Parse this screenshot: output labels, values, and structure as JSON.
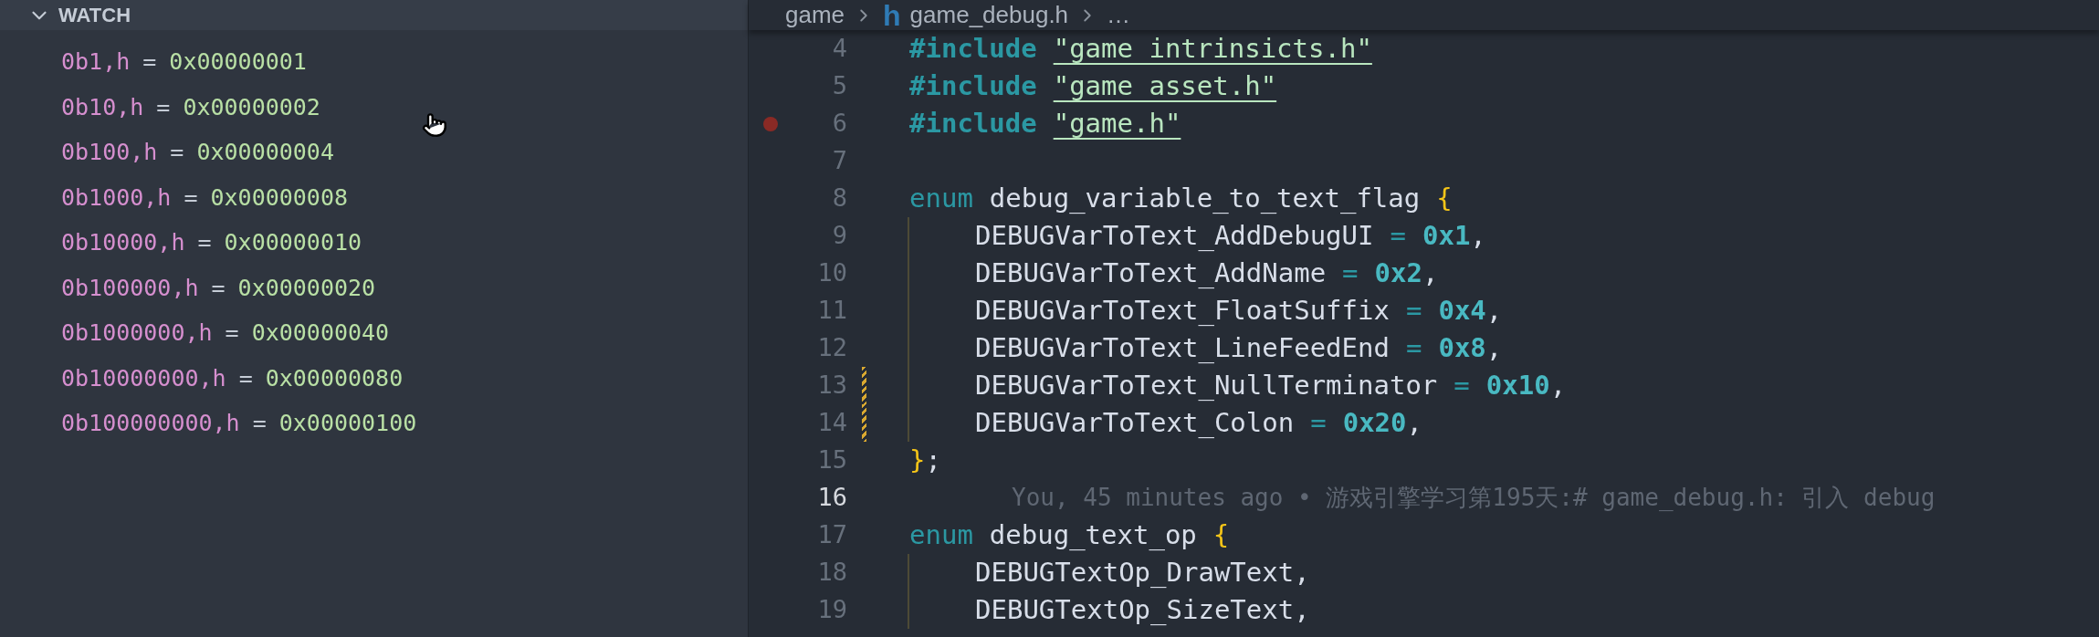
{
  "watch_panel": {
    "title": "WATCH",
    "expanded": true,
    "items": [
      {
        "expression": "0b1,h",
        "operator": "=",
        "value": "0x00000001"
      },
      {
        "expression": "0b10,h",
        "operator": "=",
        "value": "0x00000002"
      },
      {
        "expression": "0b100,h",
        "operator": "=",
        "value": "0x00000004"
      },
      {
        "expression": "0b1000,h",
        "operator": "=",
        "value": "0x00000008"
      },
      {
        "expression": "0b10000,h",
        "operator": "=",
        "value": "0x00000010"
      },
      {
        "expression": "0b100000,h",
        "operator": "=",
        "value": "0x00000020"
      },
      {
        "expression": "0b1000000,h",
        "operator": "=",
        "value": "0x00000040"
      },
      {
        "expression": "0b10000000,h",
        "operator": "=",
        "value": "0x00000080"
      },
      {
        "expression": "0b100000000,h",
        "operator": "=",
        "value": "0x00000100"
      }
    ]
  },
  "breadcrumb": {
    "folder": "game",
    "file_glyph": "h",
    "file": "game_debug.h",
    "more": "…"
  },
  "editor": {
    "lines": [
      {
        "number": "4",
        "current": false,
        "breakpoint": false,
        "modified": false,
        "indented": false,
        "tokens": [
          {
            "kind": "keyword",
            "text": "#include"
          },
          {
            "kind": "string",
            "text": "\"game_intrinsicts.h\""
          }
        ]
      },
      {
        "number": "5",
        "current": false,
        "breakpoint": false,
        "modified": false,
        "indented": false,
        "tokens": [
          {
            "kind": "keyword",
            "text": "#include"
          },
          {
            "kind": "string",
            "text": "\"game_asset.h\""
          }
        ]
      },
      {
        "number": "6",
        "current": false,
        "breakpoint": true,
        "modified": false,
        "indented": false,
        "tokens": [
          {
            "kind": "keyword",
            "text": "#include"
          },
          {
            "kind": "string",
            "text": "\"game.h\""
          }
        ]
      },
      {
        "number": "7",
        "current": false,
        "breakpoint": false,
        "modified": false,
        "indented": false
      },
      {
        "number": "8",
        "current": false,
        "breakpoint": false,
        "modified": false,
        "indented": false,
        "tokens": [
          {
            "kind": "storage",
            "text": "enum"
          },
          {
            "kind": "plain",
            "text": "debug_variable_to_text_flag"
          },
          {
            "kind": "brace",
            "text": "{"
          }
        ]
      },
      {
        "number": "9",
        "current": false,
        "breakpoint": false,
        "modified": false,
        "indented": true,
        "tokens": [
          {
            "kind": "plain",
            "text": "DEBUGVarToText_AddDebugUI"
          },
          {
            "kind": "operator",
            "text": "="
          },
          {
            "kind": "number",
            "text": "0x1"
          },
          {
            "kind": "punct",
            "text": ","
          }
        ]
      },
      {
        "number": "10",
        "current": false,
        "breakpoint": false,
        "modified": false,
        "indented": true,
        "tokens": [
          {
            "kind": "plain",
            "text": "DEBUGVarToText_AddName"
          },
          {
            "kind": "operator",
            "text": "="
          },
          {
            "kind": "number",
            "text": "0x2"
          },
          {
            "kind": "punct",
            "text": ","
          }
        ]
      },
      {
        "number": "11",
        "current": false,
        "breakpoint": false,
        "modified": false,
        "indented": true,
        "tokens": [
          {
            "kind": "plain",
            "text": "DEBUGVarToText_FloatSuffix"
          },
          {
            "kind": "operator",
            "text": "="
          },
          {
            "kind": "number",
            "text": "0x4"
          },
          {
            "kind": "punct",
            "text": ","
          }
        ]
      },
      {
        "number": "12",
        "current": false,
        "breakpoint": false,
        "modified": false,
        "indented": true,
        "tokens": [
          {
            "kind": "plain",
            "text": "DEBUGVarToText_LineFeedEnd"
          },
          {
            "kind": "operator",
            "text": "="
          },
          {
            "kind": "number",
            "text": "0x8"
          },
          {
            "kind": "punct",
            "text": ","
          }
        ]
      },
      {
        "number": "13",
        "current": false,
        "breakpoint": false,
        "modified": true,
        "indented": true,
        "tokens": [
          {
            "kind": "plain",
            "text": "DEBUGVarToText_NullTerminator"
          },
          {
            "kind": "operator",
            "text": "="
          },
          {
            "kind": "number",
            "text": "0x10"
          },
          {
            "kind": "punct",
            "text": ","
          }
        ]
      },
      {
        "number": "14",
        "current": false,
        "breakpoint": false,
        "modified": true,
        "indented": true,
        "tokens": [
          {
            "kind": "plain",
            "text": "DEBUGVarToText_Colon"
          },
          {
            "kind": "operator",
            "text": "="
          },
          {
            "kind": "number",
            "text": "0x20"
          },
          {
            "kind": "punct",
            "text": ","
          }
        ]
      },
      {
        "number": "15",
        "current": false,
        "breakpoint": false,
        "modified": false,
        "indented": false,
        "tokens": [
          {
            "kind": "brace",
            "text": "}"
          },
          {
            "kind": "punct",
            "text": ";"
          }
        ]
      },
      {
        "number": "16",
        "current": true,
        "breakpoint": false,
        "modified": false,
        "indented": false,
        "tokens": [
          {
            "kind": "blame",
            "text": "You, 45 minutes ago • 游戏引擎学习第195天:# game_debug.h: 引入 debug"
          }
        ]
      },
      {
        "number": "17",
        "current": false,
        "breakpoint": false,
        "modified": false,
        "indented": false,
        "tokens": [
          {
            "kind": "storage",
            "text": "enum"
          },
          {
            "kind": "plain",
            "text": "debug_text_op"
          },
          {
            "kind": "brace",
            "text": "{"
          }
        ]
      },
      {
        "number": "18",
        "current": false,
        "breakpoint": false,
        "modified": false,
        "indented": true,
        "tokens": [
          {
            "kind": "plain",
            "text": "DEBUGTextOp_DrawText"
          },
          {
            "kind": "punct",
            "text": ","
          }
        ]
      },
      {
        "number": "19",
        "current": false,
        "breakpoint": false,
        "modified": false,
        "indented": true,
        "tokens": [
          {
            "kind": "plain",
            "text": "DEBUGTextOp_SizeText"
          },
          {
            "kind": "punct",
            "text": ","
          }
        ]
      }
    ]
  }
}
